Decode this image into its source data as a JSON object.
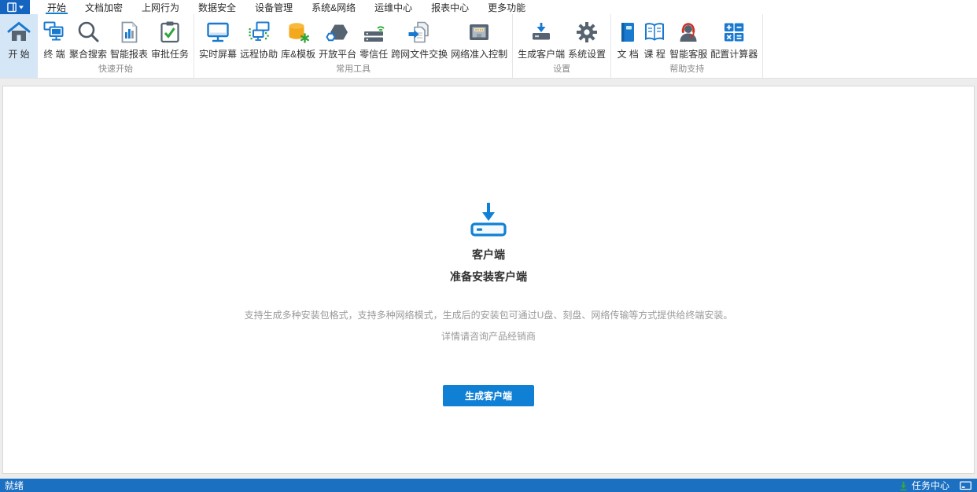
{
  "colors": {
    "accent_blue": "#1080d4",
    "icon_blue": "#1879cf",
    "statusbar_blue": "#1c70c2",
    "home_highlight": "#d5e6f7"
  },
  "menubar": {
    "tabs": [
      {
        "label": "开始",
        "active": true
      },
      {
        "label": "文档加密",
        "active": false
      },
      {
        "label": "上网行为",
        "active": false
      },
      {
        "label": "数据安全",
        "active": false
      },
      {
        "label": "设备管理",
        "active": false
      },
      {
        "label": "系统&网络",
        "active": false
      },
      {
        "label": "运维中心",
        "active": false
      },
      {
        "label": "报表中心",
        "active": false
      },
      {
        "label": "更多功能",
        "active": false
      }
    ]
  },
  "ribbon": {
    "home": {
      "label": "开 始",
      "icon": "home-icon"
    },
    "groups": [
      {
        "caption": "快速开始",
        "items": [
          {
            "label": "终 端",
            "icon": "terminal-icon"
          },
          {
            "label": "聚合搜索",
            "icon": "search-icon"
          },
          {
            "label": "智能报表",
            "icon": "smart-report-icon"
          },
          {
            "label": "审批任务",
            "icon": "approval-tasks-icon"
          }
        ]
      },
      {
        "caption": "常用工具",
        "items": [
          {
            "label": "实时屏幕",
            "icon": "realtime-screen-icon"
          },
          {
            "label": "远程协助",
            "icon": "remote-assist-icon"
          },
          {
            "label": "库&模板",
            "icon": "library-template-icon"
          },
          {
            "label": "开放平台",
            "icon": "open-platform-icon"
          },
          {
            "label": "零信任",
            "icon": "zero-trust-icon"
          },
          {
            "label": "跨网文件交换",
            "icon": "file-exchange-icon"
          },
          {
            "label": "网络准入控制",
            "icon": "network-access-icon"
          }
        ]
      },
      {
        "caption": "设置",
        "items": [
          {
            "label": "生成客户端",
            "icon": "generate-client-icon"
          },
          {
            "label": "系统设置",
            "icon": "system-settings-icon"
          }
        ]
      },
      {
        "caption": "帮助支持",
        "items": [
          {
            "label": "文 档",
            "icon": "document-icon"
          },
          {
            "label": "课 程",
            "icon": "course-icon"
          },
          {
            "label": "智能客服",
            "icon": "support-agent-icon"
          },
          {
            "label": "配置计算器",
            "icon": "calculator-icon"
          }
        ]
      }
    ]
  },
  "main": {
    "title": "客户端",
    "subtitle": "准备安装客户端",
    "description_line1": "支持生成多种安装包格式，支持多种网络模式，生成后的安装包可通过U盘、刻盘、网络传输等方式提供给终端安装。",
    "description_line2": "详情请咨询产品经销商",
    "generate_button": "生成客户端"
  },
  "statusbar": {
    "status": "就绪",
    "task_center": "任务中心"
  }
}
